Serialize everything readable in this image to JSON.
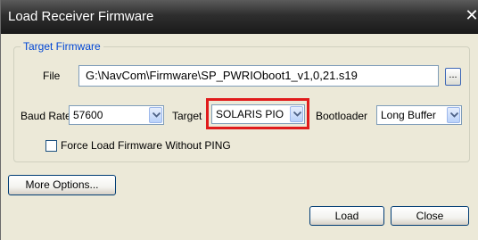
{
  "window": {
    "title": "Load Receiver Firmware",
    "close_glyph": "✕"
  },
  "target_firmware": {
    "legend": "Target Firmware",
    "file_label": "File",
    "file_path": "G:\\NavCom\\Firmware\\SP_PWRIOboot1_v1,0,21.s19",
    "browse_label": "...",
    "baud_rate_label": "Baud Rate",
    "baud_rate_value": "57600",
    "target_label": "Target",
    "target_value": "SOLARIS PIO",
    "bootloader_label": "Bootloader",
    "bootloader_value": "Long Buffer",
    "force_load_label": "Force Load Firmware Without PING",
    "force_load_checked": false
  },
  "buttons": {
    "more_options": "More Options...",
    "load": "Load",
    "close": "Close"
  },
  "colors": {
    "highlight": "#e01b1b",
    "legend_text": "#0046d5"
  }
}
